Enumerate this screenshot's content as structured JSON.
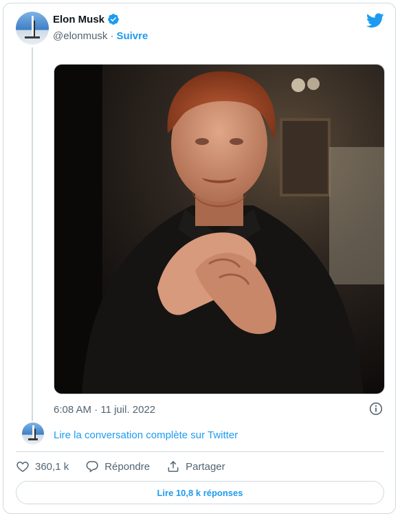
{
  "author": {
    "display_name": "Elon Musk",
    "handle": "@elonmusk",
    "separator": "·",
    "follow_label": "Suivre",
    "verified": true
  },
  "tweet": {
    "media_description_icon": "photo",
    "timestamp": "6:08 AM · 11 juil. 2022"
  },
  "conversation": {
    "link_label": "Lire la conversation complète sur Twitter"
  },
  "actions": {
    "likes": "360,1 k",
    "reply_label": "Répondre",
    "share_label": "Partager"
  },
  "replies_button": {
    "label": "Lire 10,8 k réponses"
  },
  "colors": {
    "accent": "#1d9bf0",
    "secondary_text": "#536471",
    "border": "#cfd9de"
  }
}
